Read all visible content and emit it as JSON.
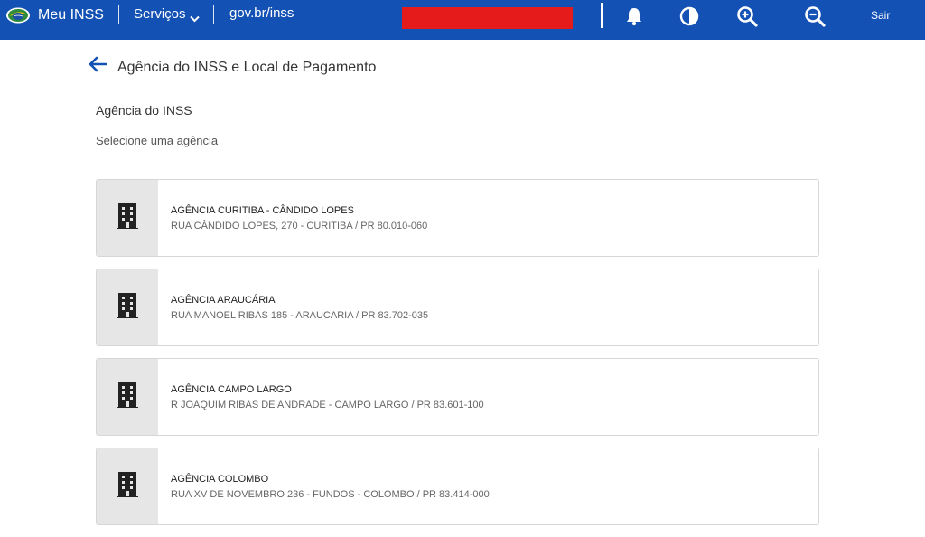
{
  "header": {
    "app_name": "Meu INSS",
    "services_label": "Serviços",
    "portal_link": "gov.br/inss",
    "logout_label": "Sair",
    "colors": {
      "bar": "#1351b4",
      "redaction": "#e51b1b"
    },
    "tools": [
      "bell-icon",
      "contrast-icon",
      "zoom-in-icon",
      "zoom-out-icon"
    ]
  },
  "page": {
    "title": "Agência do INSS e Local de Pagamento",
    "section_title": "Agência do INSS",
    "section_hint": "Selecione uma agência"
  },
  "agencies": [
    {
      "name": "AGÊNCIA CURITIBA - CÂNDIDO LOPES",
      "address": "RUA CÂNDIDO LOPES, 270 - CURITIBA / PR 80.010-060"
    },
    {
      "name": "AGÊNCIA ARAUCÁRIA",
      "address": "RUA MANOEL RIBAS 185 - ARAUCARIA / PR 83.702-035"
    },
    {
      "name": "AGÊNCIA CAMPO LARGO",
      "address": "R JOAQUIM RIBAS DE ANDRADE - CAMPO LARGO / PR 83.601-100"
    },
    {
      "name": "AGÊNCIA COLOMBO",
      "address": "RUA XV DE NOVEMBRO 236 - FUNDOS - COLOMBO / PR 83.414-000"
    }
  ]
}
